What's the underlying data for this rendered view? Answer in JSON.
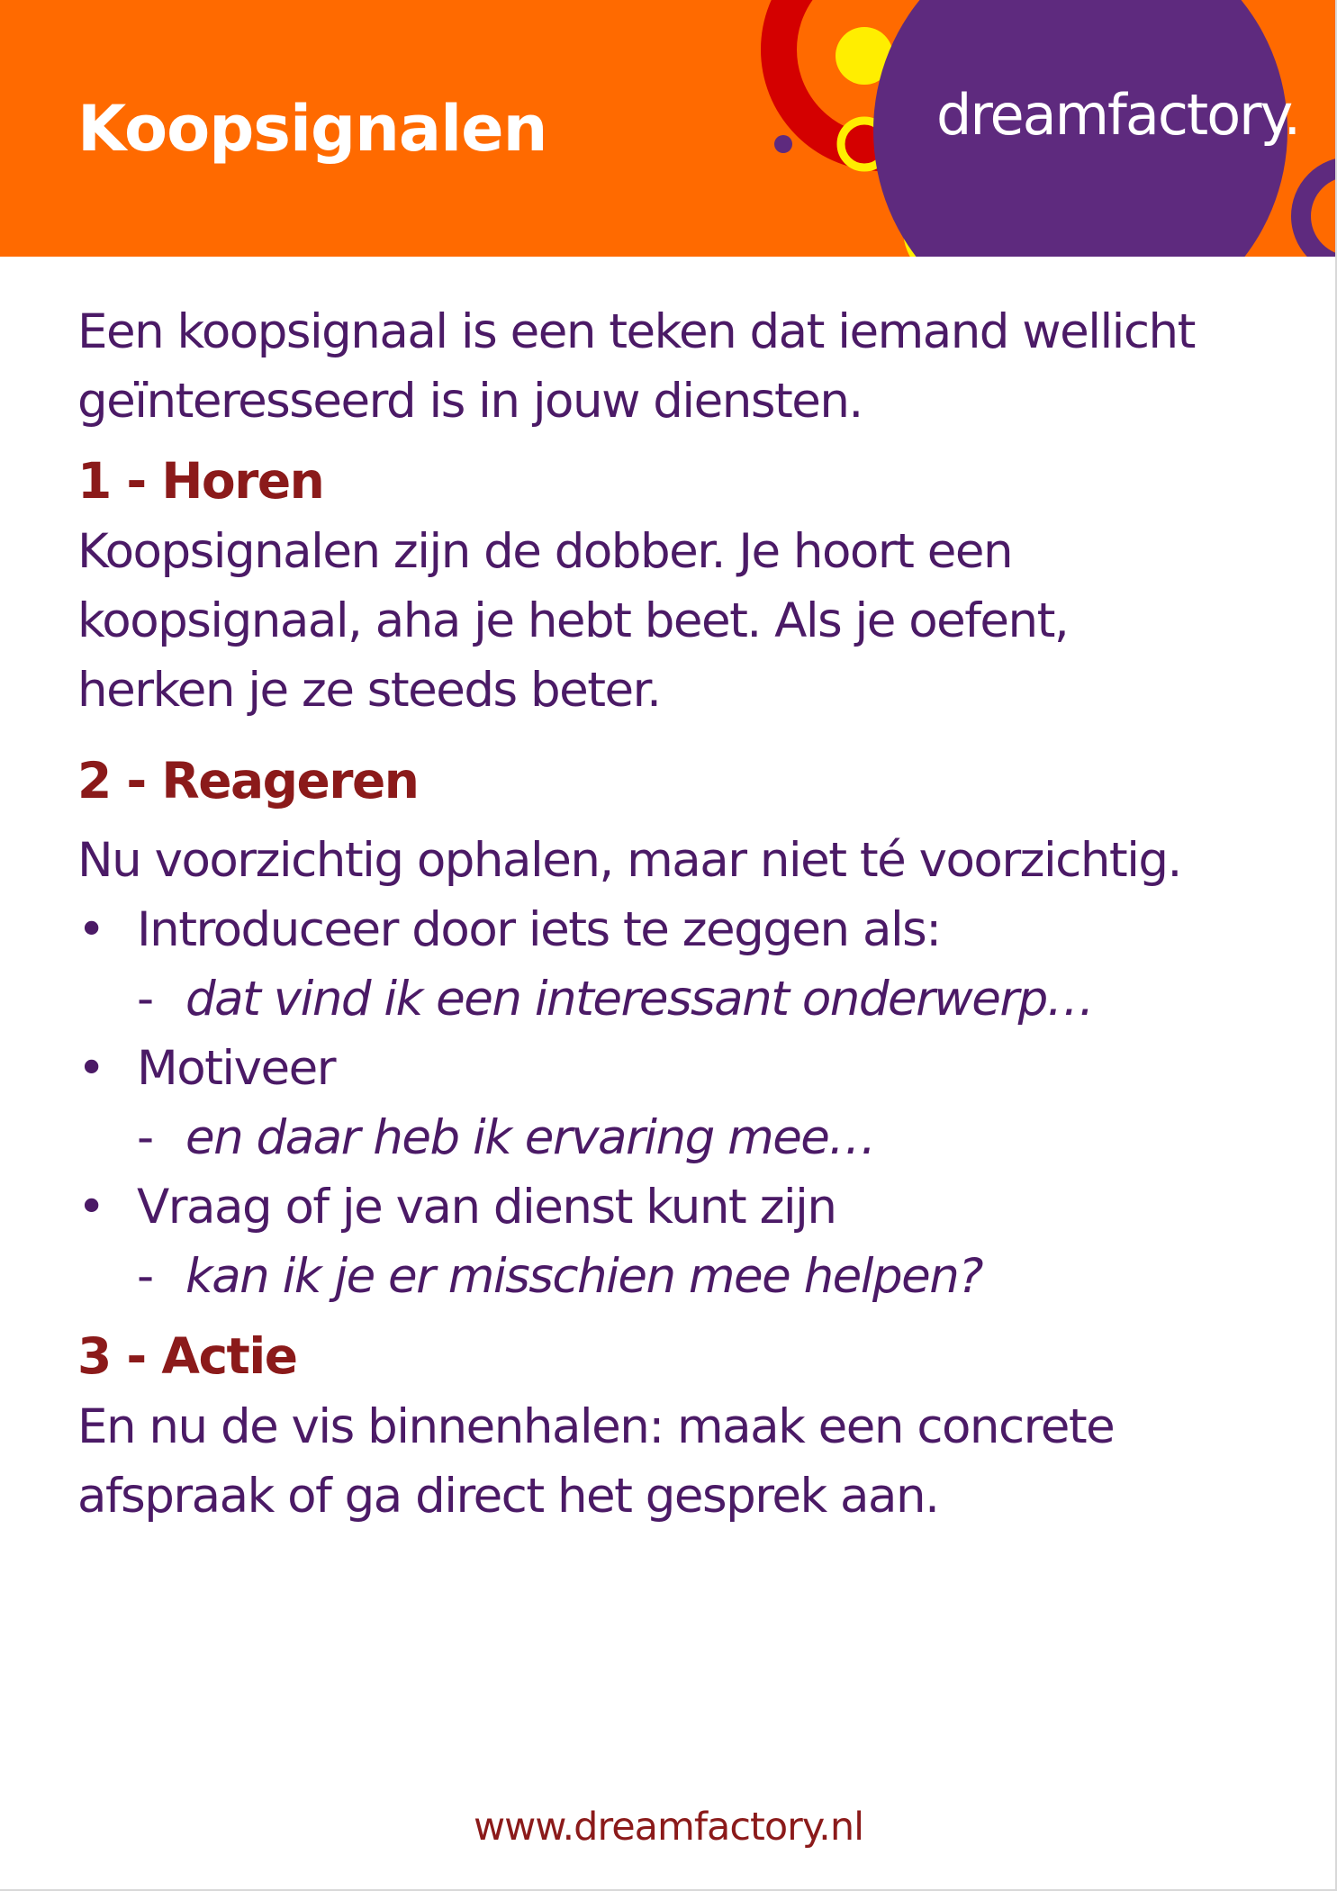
{
  "header": {
    "title": "Koopsignalen",
    "logo": "dreamfactory."
  },
  "colors": {
    "header_bg": "#ff6a00",
    "logo_circle": "#5e2a7e",
    "body_text": "#4b1a66",
    "heading_text": "#8b1a1a",
    "accent_red": "#d40000",
    "accent_yellow": "#ffee00"
  },
  "intro": {
    "line1": "Een koopsignaal is een teken dat iemand wellicht",
    "line2": "geïnteresseerd is in jouw diensten."
  },
  "sections": [
    {
      "heading": "1 - Horen",
      "lines": [
        "Koopsignalen zijn de dobber. Je hoort  een",
        "koopsignaal, aha je hebt beet. Als je oefent,",
        "herken je ze steeds beter."
      ]
    },
    {
      "heading": "2 - Reageren",
      "lead": "Nu voorzichtig ophalen, maar niet té voorzichtig.",
      "bullets": [
        {
          "marker": "•",
          "text": "Introduceer door iets te zeggen als:",
          "dash": "-",
          "example": "dat vind ik een interessant onderwerp…"
        },
        {
          "marker": "•",
          "text": "Motiveer",
          "dash": "-",
          "example": "en daar heb ik ervaring mee…"
        },
        {
          "marker": "•",
          "text": "Vraag of je van dienst kunt zijn",
          "dash": "-",
          "example": "kan ik je er misschien mee helpen?"
        }
      ]
    },
    {
      "heading": "3 - Actie",
      "lines": [
        "En nu de vis binnenhalen: maak een concrete",
        "afspraak of ga direct het gesprek aan."
      ]
    }
  ],
  "footer": {
    "url": "www.dreamfactory.nl"
  }
}
